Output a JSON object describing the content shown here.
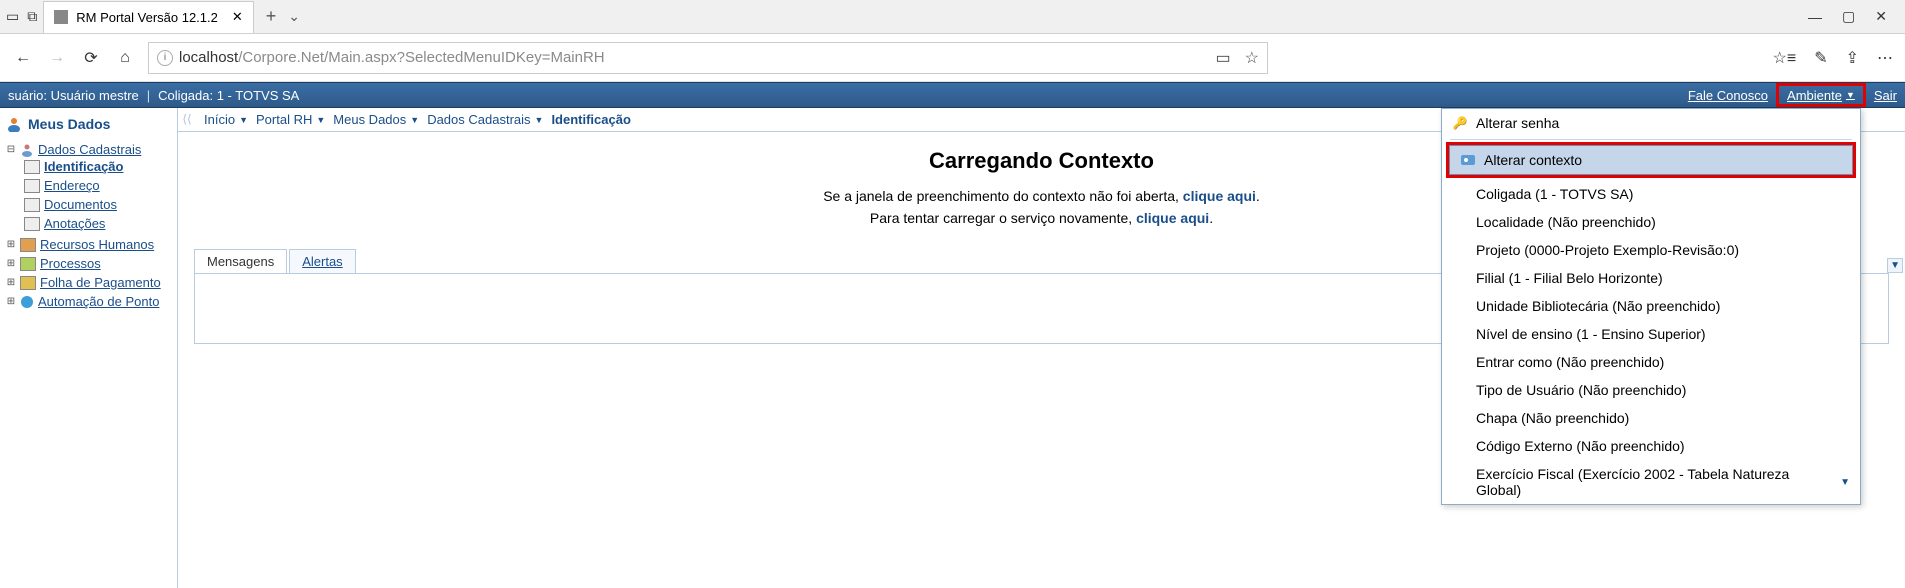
{
  "browser": {
    "tab_title": "RM Portal Versão 12.1.2",
    "url_host": "localhost",
    "url_path": "/Corpore.Net/Main.aspx?SelectedMenuIDKey=MainRH"
  },
  "header": {
    "usuario_label": "suário: Usuário mestre",
    "coligada_label": "Coligada: 1 - TOTVS SA",
    "fale_conosco": "Fale Conosco",
    "ambiente": "Ambiente",
    "sair": "Sair"
  },
  "sidebar": {
    "title": "Meus Dados",
    "items": [
      {
        "label": "Dados Cadastrais"
      },
      {
        "label": "Identificação"
      },
      {
        "label": "Endereço"
      },
      {
        "label": "Documentos"
      },
      {
        "label": "Anotações"
      },
      {
        "label": "Recursos Humanos"
      },
      {
        "label": "Processos"
      },
      {
        "label": "Folha de Pagamento"
      },
      {
        "label": "Automação de Ponto"
      }
    ]
  },
  "breadcrumb": {
    "items": [
      "Início",
      "Portal RH",
      "Meus Dados",
      "Dados Cadastrais"
    ],
    "active": "Identificação"
  },
  "content": {
    "title": "Carregando Contexto",
    "line1_pre": "Se a janela de preenchimento do contexto não foi aberta, ",
    "line2_pre": "Para tentar carregar o serviço novamente, ",
    "link_text": "clique aqui",
    "dot": "."
  },
  "tabs": {
    "mensagens": "Mensagens",
    "alertas": "Alertas"
  },
  "dropdown": {
    "alterar_senha": "Alterar senha",
    "alterar_contexto": "Alterar contexto",
    "items": [
      "Coligada (1 - TOTVS SA)",
      "Localidade (Não preenchido)",
      "Projeto (0000-Projeto Exemplo-Revisão:0)",
      "Filial (1 - Filial Belo Horizonte)",
      "Unidade Bibliotecária (Não preenchido)",
      "Nível de ensino (1 - Ensino Superior)",
      "Entrar como (Não preenchido)",
      "Tipo de Usuário (Não preenchido)",
      "Chapa (Não preenchido)",
      "Código Externo (Não preenchido)",
      "Exercício Fiscal (Exercício 2002 - Tabela Natureza Global)"
    ]
  }
}
